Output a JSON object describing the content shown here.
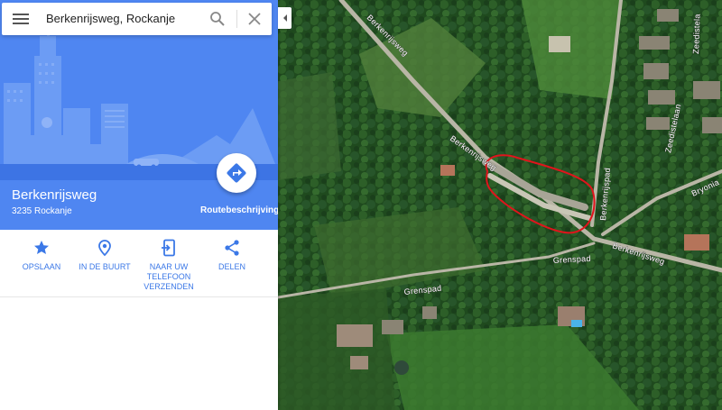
{
  "search": {
    "value": "Berkenrijsweg, Rockanje"
  },
  "place": {
    "name": "Berkenrijsweg",
    "address": "3235 Rockanje"
  },
  "directions": {
    "label": "Routebeschrijving"
  },
  "actions": [
    {
      "label": "OPSLAAN",
      "icon": "star-icon"
    },
    {
      "label": "IN DE BUURT",
      "icon": "location-pin-icon"
    },
    {
      "label": "NAAR UW TELEFOON VERZENDEN",
      "icon": "send-to-phone-icon"
    },
    {
      "label": "DELEN",
      "icon": "share-icon"
    }
  ],
  "map": {
    "view": "satellite",
    "streets": [
      "Berkenrijsweg",
      "Berkenrijsweg",
      "Berkenrijspad",
      "Grenspad",
      "Grenspad",
      "Zeedistelaan",
      "Bryonia",
      "Berkenrijsweg",
      "Zeedistela"
    ],
    "highlight_color": "#e0141c"
  },
  "colors": {
    "accent": "#4f86f1",
    "action_text": "#3b78e7"
  }
}
